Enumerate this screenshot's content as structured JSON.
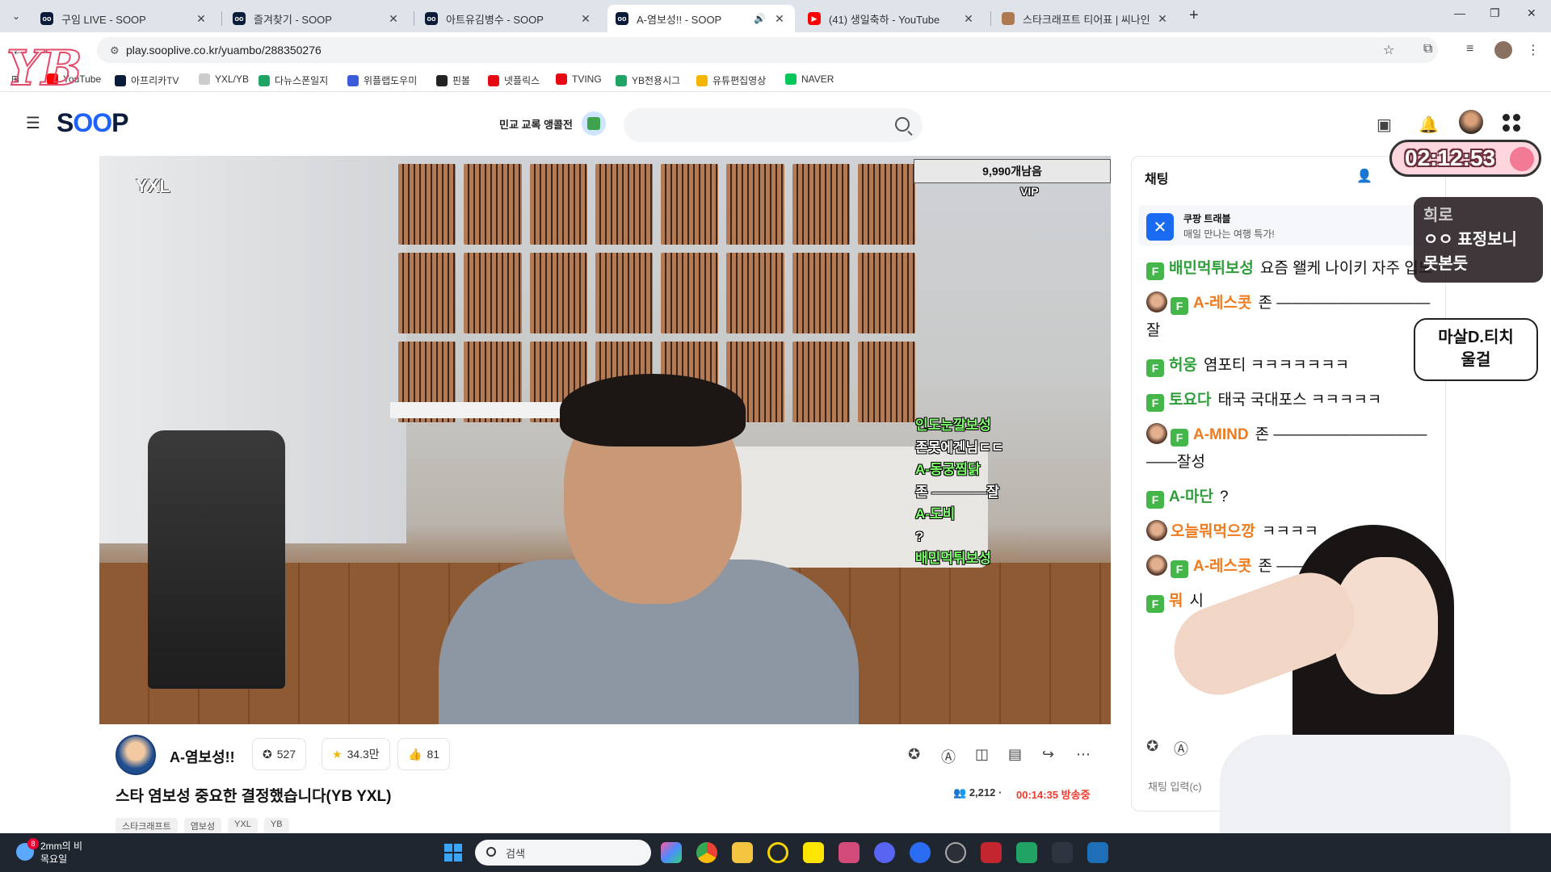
{
  "browser": {
    "tabs": [
      {
        "title": "구임 LIVE - SOOP",
        "active": false
      },
      {
        "title": "즐겨찾기 - SOOP",
        "active": false
      },
      {
        "title": "아트유김병수 - SOOP",
        "active": false
      },
      {
        "title": "A-염보성!! - SOOP",
        "active": true
      },
      {
        "title": "(41) 생일축하 - YouTube",
        "active": false
      },
      {
        "title": "스타크래프트 티어표 | 씨나인",
        "active": false
      }
    ],
    "url": "play.sooplive.co.kr/yuambo/288350276",
    "bookmarks": [
      "YouTube",
      "아프리카TV",
      "YXL/YB",
      "다뉴스폰일지",
      "위플랩도우미",
      "핀볼",
      "넷플릭스",
      "TVING",
      "YB전용시그",
      "유튜편집영상",
      "NAVER"
    ]
  },
  "site": {
    "logo": "SOOP",
    "promo_text": "민교 교록 앵콜전",
    "search_placeholder": ""
  },
  "video": {
    "watermark": "YXL",
    "balloon_counter": "9,990개남음",
    "vip_label": "VIP",
    "overlay_chat": [
      {
        "name": "인도눈깔보성",
        "text": "존못에겐님ㄷㄷ"
      },
      {
        "name": "A-동궁찜닭",
        "text": "존 ————잘"
      },
      {
        "name": "A-도비",
        "text": "?"
      },
      {
        "name": "배민먹튀보성",
        "text": ""
      }
    ]
  },
  "channel": {
    "name": "A-염보성!!",
    "avatar_label": "염보성",
    "stat_subscribe": "527",
    "stat_favorite": "34.3만",
    "stat_like": "81",
    "title": "스타 염보성 중요한 결정했습니다(YB YXL)",
    "viewers": "2,212",
    "elapsed": "00:14:35 방송중",
    "tags": [
      "스타크래프트",
      "염보성",
      "YXL",
      "YB"
    ]
  },
  "chat": {
    "header": "채팅",
    "ad": {
      "title": "쿠팡 트래블",
      "subtitle": "매일 만나는 여행 특가!"
    },
    "messages": [
      {
        "avatar": false,
        "badge": "F",
        "nick": "배민먹튀보성",
        "color": "green",
        "text": "요즘 왤케 나이키 자주 입노"
      },
      {
        "avatar": true,
        "badge": "F",
        "nick": "A-레스콧",
        "color": "orange",
        "text": "존 —————————— 잘"
      },
      {
        "avatar": false,
        "badge": "F",
        "nick": "허웅",
        "color": "green",
        "text": "염포티 ㅋㅋㅋㅋㅋㅋㅋ"
      },
      {
        "avatar": false,
        "badge": "F",
        "nick": "토요다",
        "color": "green",
        "text": "태국 국대포스 ㅋㅋㅋㅋㅋ"
      },
      {
        "avatar": true,
        "badge": "F",
        "nick": "A-MIND",
        "color": "orange",
        "text": "존 —————————— ——잘성"
      },
      {
        "avatar": false,
        "badge": "F",
        "nick": "A-마단",
        "color": "green",
        "text": "?"
      },
      {
        "avatar": true,
        "badge": "",
        "nick": "오늘뭐먹으깡",
        "color": "orange",
        "text": "ㅋㅋㅋㅋ"
      },
      {
        "avatar": true,
        "badge": "F",
        "nick": "A-레스콧",
        "color": "orange",
        "text": "존 —— ——— 장"
      },
      {
        "avatar": false,
        "badge": "F",
        "nick": "뭐",
        "color": "orange",
        "text": "시"
      }
    ],
    "input_placeholder": "채팅 입력(c)"
  },
  "overlays": {
    "timer": "02:12:53",
    "dark_bubble": {
      "line1": "희로",
      "line2": "ㅇㅇ 표정보니",
      "line3": "못본듯"
    },
    "white_bubble": {
      "line1": "마살D.티치",
      "line2": "울걸"
    }
  },
  "taskbar": {
    "weather_line1": "2mm의 비",
    "weather_line2": "목요일",
    "weather_badge": "8",
    "search_placeholder": "검색"
  },
  "colors": {
    "accent_blue": "#1e63ff",
    "chat_green": "#2f9e3a",
    "chat_orange": "#f07a1e",
    "live_red": "#ef3b2f"
  }
}
